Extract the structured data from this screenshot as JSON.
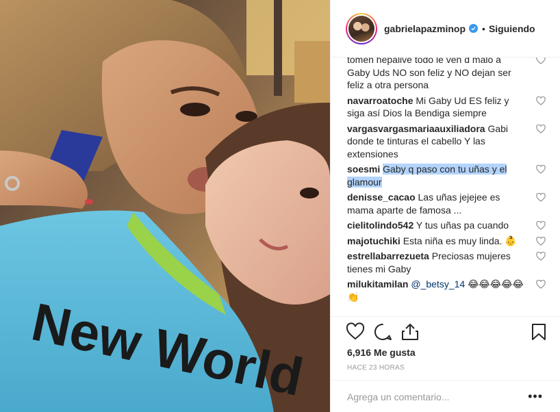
{
  "post": {
    "username": "gabrielapazminop",
    "follow_separator": "•",
    "follow_status": "Siguiendo",
    "likes_text": "6,916 Me gusta",
    "time_text": "HACE 23 HORAS",
    "add_comment_placeholder": "Agrega un comentario...",
    "more_options": "•••",
    "photo_print_text": "New World"
  },
  "comments": [
    {
      "user": "",
      "text": "tomen hepalive todo le ven d malo a Gaby Uds NO son feliz y NO dejan ser feliz a otra persona"
    },
    {
      "user": "navarroatoche",
      "text": "Mi Gaby Ud ES feliz y siga así Dios la Bendiga siempre"
    },
    {
      "user": "vargasvargasmariaauxiliadora",
      "text": "Gabi donde te tinturas el cabello Y las extensiones"
    },
    {
      "user": "soesmi",
      "text": "Gaby q paso con tu uñas y el glamour",
      "highlighted": true
    },
    {
      "user": "denisse_cacao",
      "text": "Las uñas jejejee es mama aparte de famosa ..."
    },
    {
      "user": "cielitolindo542",
      "text": "Y tus uñas pa cuando"
    },
    {
      "user": "majotuchiki",
      "text": "Esta niña es muy linda. 👶"
    },
    {
      "user": "estrellabarrezueta",
      "text": "Preciosas mujeres tienes mi Gaby"
    },
    {
      "user": "milukitamilan",
      "mention": "@_betsy_14",
      "text": "😂😂😂😂😂👏"
    }
  ],
  "colors": {
    "verified": "#3897f0",
    "highlight": "#b3d4fc",
    "shirt": "#5ab8d8",
    "collar": "#9ad24a"
  },
  "icons": [
    "heart-icon",
    "comment-icon",
    "share-icon",
    "bookmark-icon",
    "verified-badge-icon",
    "like-heart-icon"
  ]
}
